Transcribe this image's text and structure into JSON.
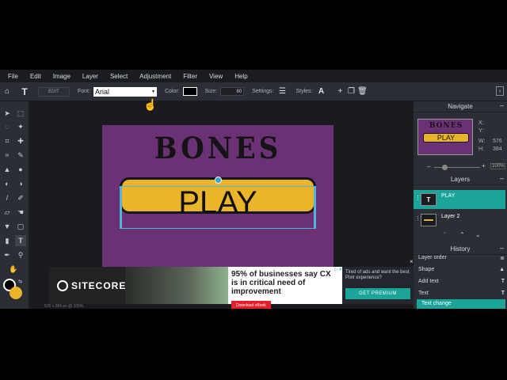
{
  "menu": [
    "File",
    "Edit",
    "Image",
    "Layer",
    "Select",
    "Adjustment",
    "Filter",
    "View",
    "Help"
  ],
  "toolbar": {
    "edit_label": "EDIT",
    "font_label": "Font:",
    "font_value": "Arial",
    "color_label": "Color:",
    "size_label": "Size:",
    "size_value": "80",
    "settings_label": "Settings:",
    "styles_label": "Styles:"
  },
  "canvas": {
    "bones_text": "BONES",
    "play_text": "PLAY",
    "bg_color": "#6a3275",
    "button_color": "#eab52b"
  },
  "status": "576 x 384 px @ 100%",
  "ad": {
    "brand": "SITECORE",
    "headline": "95% of businesses say CX is in critical need of improvement",
    "cta": "Download eBook"
  },
  "premium": {
    "text": "Tired of ads and want the best Pixlr experience?",
    "button": "GET PREMIUM"
  },
  "navigate": {
    "title": "Navigate",
    "thumb_bones": "BONES",
    "thumb_play": "PLAY",
    "x_label": "X:",
    "y_label": "Y:",
    "w_label": "W:",
    "w_value": "576",
    "h_label": "H:",
    "h_value": "384",
    "zoom": "100%"
  },
  "layers": {
    "title": "Layers",
    "items": [
      {
        "name": "PLAY",
        "selected": true
      },
      {
        "name": "Layer 2",
        "selected": false
      }
    ]
  },
  "history": {
    "title": "History",
    "items": [
      "Layer order",
      "Shape",
      "Add text",
      "Text",
      "Text change"
    ]
  }
}
